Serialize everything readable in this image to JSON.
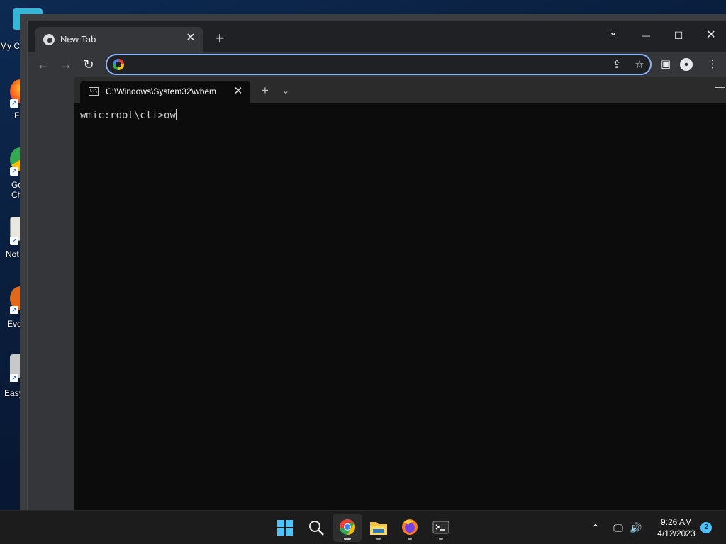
{
  "desktop": {
    "icons": [
      {
        "label": "My C",
        "name": "my-computer"
      },
      {
        "label": "Fi",
        "name": "firefox"
      },
      {
        "label": "Go Ch",
        "name": "google-chrome"
      },
      {
        "label": "Not",
        "name": "notepad"
      },
      {
        "label": "Eve",
        "name": "everything"
      },
      {
        "label": "Easy",
        "name": "easy"
      }
    ]
  },
  "chrome": {
    "tab_title": "New Tab",
    "tab_close": "✕",
    "new_tab": "+",
    "omnibox_value": "",
    "controls": {
      "dropdown": "⌄",
      "minimize": "—",
      "maximize": "☐",
      "close": "✕"
    }
  },
  "terminal": {
    "tab_title": "C:\\Windows\\System32\\wbem",
    "tab_close": "✕",
    "new_tab": "+",
    "dropdown": "⌄",
    "prompt": "wmic:root\\cli>",
    "input": "ow"
  },
  "taskbar": {
    "apps": [
      "start",
      "search",
      "chrome",
      "file-explorer",
      "firefox",
      "terminal"
    ],
    "time": "9:26 AM",
    "date": "4/12/2023",
    "notification_count": "2"
  },
  "colors": {
    "accent": "#8ab4f8",
    "windows_accent": "#4cc2ff",
    "terminal_bg": "#0c0c0c",
    "chrome_toolbar": "#35363a"
  }
}
